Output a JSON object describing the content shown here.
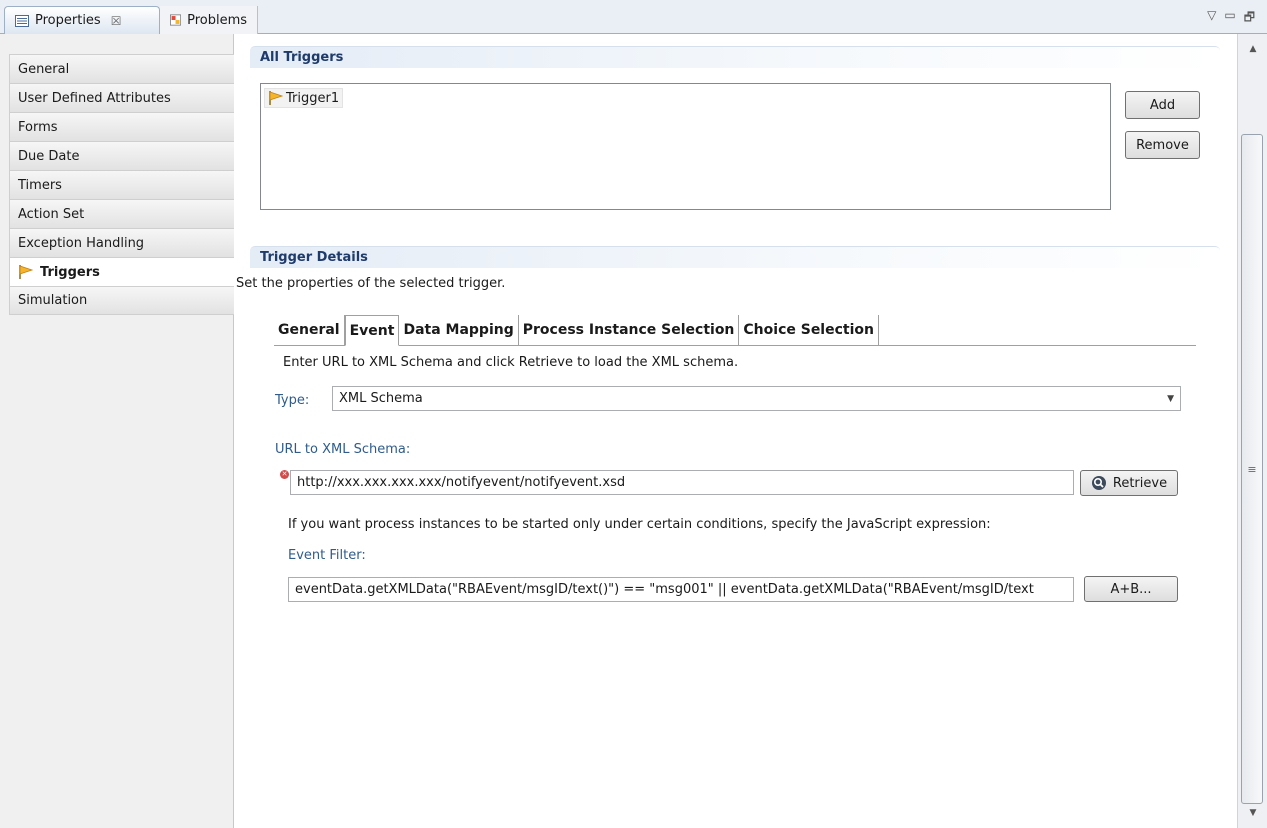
{
  "view_tabs": [
    {
      "label": "Properties",
      "active": true,
      "close": "☒"
    },
    {
      "label": "Problems",
      "active": false
    }
  ],
  "view_controls": [
    "▽",
    "▭",
    "🗗"
  ],
  "sidebar": {
    "items": [
      {
        "label": "General"
      },
      {
        "label": "User Defined Attributes"
      },
      {
        "label": "Forms"
      },
      {
        "label": "Due Date"
      },
      {
        "label": "Timers"
      },
      {
        "label": "Action Set"
      },
      {
        "label": "Exception Handling"
      },
      {
        "label": "Triggers",
        "selected": true
      },
      {
        "label": "Simulation"
      }
    ]
  },
  "all_triggers": {
    "title": "All Triggers",
    "items": [
      "Trigger1"
    ],
    "add_label": "Add",
    "remove_label": "Remove"
  },
  "trigger_details": {
    "title": "Trigger Details",
    "description": "Set the properties of the selected trigger.",
    "tabs": [
      {
        "label": "General"
      },
      {
        "label": "Event",
        "active": true
      },
      {
        "label": "Data Mapping"
      },
      {
        "label": "Process Instance Selection"
      },
      {
        "label": "Choice Selection"
      }
    ],
    "instruction": "Enter URL to XML Schema and click Retrieve to load the XML schema.",
    "type_label": "Type:",
    "type_value": "XML Schema",
    "url_label": "URL to XML Schema:",
    "url_value": "http://xxx.xxx.xxx.xxx/notifyevent/notifyevent.xsd",
    "retrieve_label": "Retrieve",
    "condition_text": "If you want process instances to be started only under certain conditions, specify the JavaScript expression:",
    "filter_label": "Event Filter:",
    "filter_value": "eventData.getXMLData(\"RBAEvent/msgID/text()\") == \"msg001\" ||  eventData.getXMLData(\"RBAEvent/msgID/text",
    "expr_button_label": "A+B..."
  },
  "colors": {
    "accent": "#1f3b6b",
    "label_blue": "#2f5c8c",
    "error": "#d24a4a"
  }
}
